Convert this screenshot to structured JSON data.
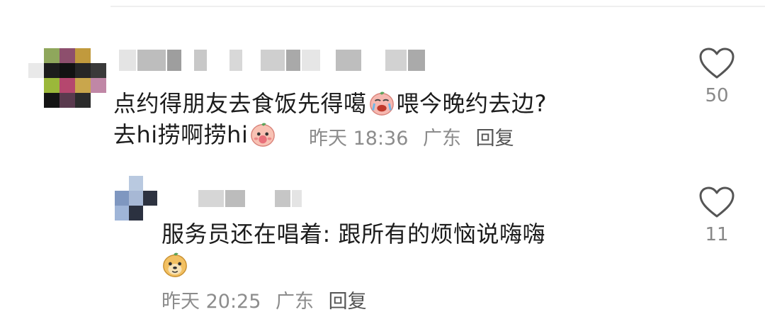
{
  "comments": [
    {
      "text_line1": "点约得朋友去食饭先得噶",
      "text_line1_after": "喂今晚约去边?",
      "text_line2": "去hi捞啊捞hi",
      "date": "昨天 18:36",
      "location": "广东",
      "reply_label": "回复",
      "like_count": "50",
      "emojis": [
        "crying-emoji",
        "blushing-emoji"
      ]
    },
    {
      "text": "服务员还在唱着: 跟所有的烦恼说嗨嗨",
      "date": "昨天 20:25",
      "location": "广东",
      "reply_label": "回复",
      "like_count": "11",
      "emojis": [
        "happy-face-emoji"
      ]
    }
  ],
  "icons": {
    "like": "heart-icon"
  },
  "colors": {
    "meta_text": "#8c8c8c",
    "heart_stroke": "#555555"
  }
}
